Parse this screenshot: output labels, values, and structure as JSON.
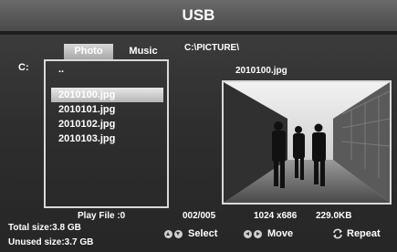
{
  "header": {
    "title": "USB"
  },
  "drive": "C:",
  "tabs": [
    {
      "label": "Photo",
      "active": true
    },
    {
      "label": "Music",
      "active": false
    }
  ],
  "path": "C:\\PICTURE\\",
  "file_list": {
    "parent": "..",
    "items": [
      "2010100.jpg",
      "2010101.jpg",
      "2010102.jpg",
      "2010103.jpg"
    ],
    "selected_index": 0
  },
  "preview": {
    "filename": "2010100.jpg"
  },
  "status": {
    "play_file": "Play File :0",
    "counter": "002/005",
    "resolution": "1024 x686",
    "file_size": "229.0KB",
    "total_size": "Total size:3.8  GB",
    "unused_size": "Unused size:3.7  GB"
  },
  "hints": {
    "select": "Select",
    "move": "Move",
    "repeat": "Repeat"
  },
  "colors": {
    "selection": "#c8c8c8",
    "border": "#d9d9d9"
  }
}
